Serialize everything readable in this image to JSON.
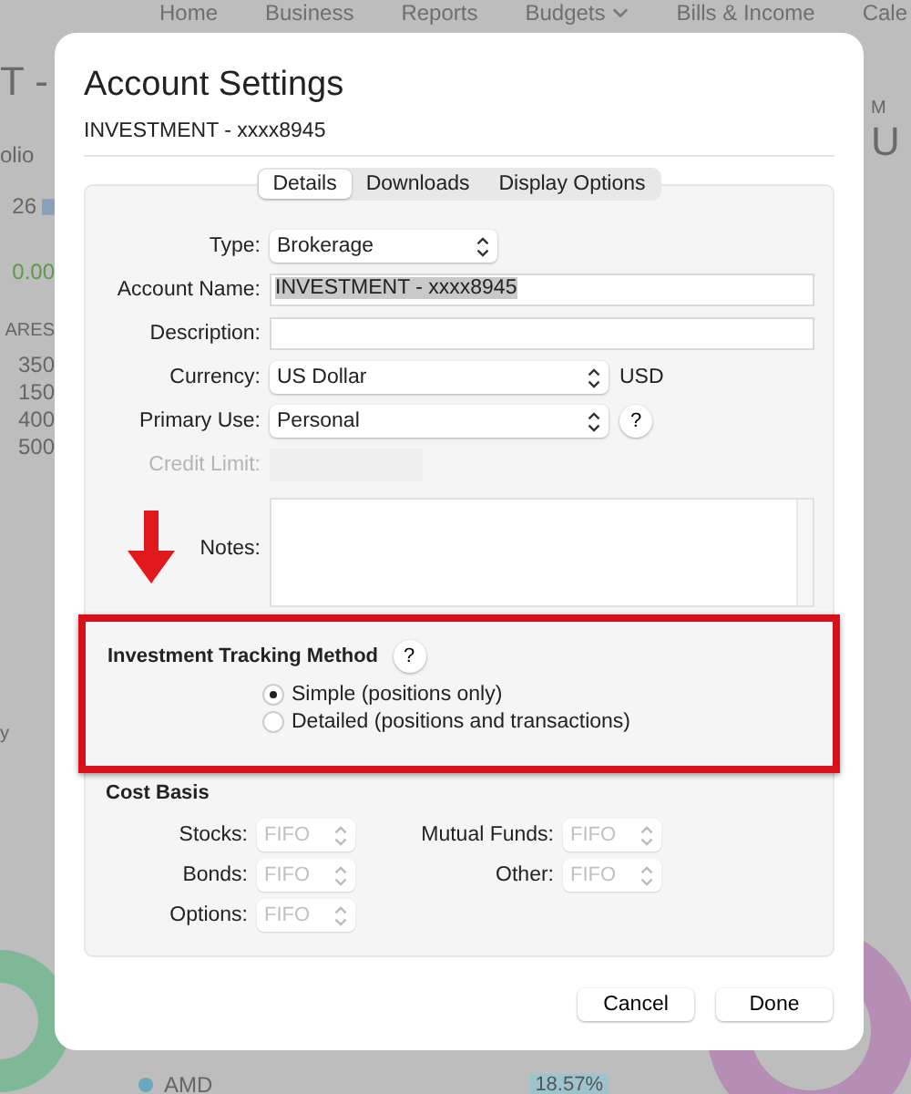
{
  "background": {
    "nav": [
      "Home",
      "Business",
      "Reports",
      "Budgets",
      "Bills & Income",
      "Cale"
    ],
    "left": {
      "title": "T -",
      "tab": "olio",
      "date": "26",
      "amount": "0.00",
      "column": "ARES",
      "numbers": [
        "350",
        "150",
        "400",
        "500"
      ],
      "footer": "y"
    },
    "right": {
      "caption": "M",
      "title": "U"
    },
    "legend": {
      "name": "AMD",
      "value": "18.57%"
    }
  },
  "dialog": {
    "title": "Account Settings",
    "subtitle": "INVESTMENT - xxxx8945",
    "tabs": [
      {
        "label": "Details",
        "selected": true
      },
      {
        "label": "Downloads",
        "selected": false
      },
      {
        "label": "Display Options",
        "selected": false
      }
    ],
    "fields": [
      {
        "kind": "popup",
        "label": "Type:",
        "value": "Brokerage",
        "disabled": false
      },
      {
        "kind": "text",
        "label": "Account Name:",
        "value": "INVESTMENT - xxxx8945",
        "disabled": false,
        "value_selected": true
      },
      {
        "kind": "text",
        "label": "Description:",
        "disabled": false
      },
      {
        "kind": "popup",
        "label": "Currency:",
        "value": "US Dollar",
        "suffix": "USD",
        "disabled": false
      },
      {
        "kind": "popup",
        "label": "Primary Use:",
        "value": "Personal",
        "help": "?",
        "disabled": false
      },
      {
        "kind": "short",
        "label": "Credit Limit:",
        "disabled": true
      },
      {
        "kind": "notes",
        "label": "Notes:",
        "disabled": false
      }
    ],
    "tracking": {
      "title": "Investment Tracking Method",
      "help": "?",
      "options": [
        {
          "label": "Simple (positions only)",
          "selected": true
        },
        {
          "label": "Detailed (positions and transactions)",
          "selected": false
        }
      ]
    },
    "cost_basis": {
      "title": "Cost Basis",
      "items": [
        {
          "label": "Stocks:",
          "value": "FIFO",
          "disabled": true
        },
        {
          "label": "Mutual Funds:",
          "value": "FIFO",
          "disabled": true
        },
        {
          "label": "Bonds:",
          "value": "FIFO",
          "disabled": true
        },
        {
          "label": "Other:",
          "value": "FIFO",
          "disabled": true
        },
        {
          "label": "Options:",
          "value": "FIFO",
          "disabled": true
        }
      ]
    },
    "buttons": [
      "Cancel",
      "Done"
    ]
  }
}
